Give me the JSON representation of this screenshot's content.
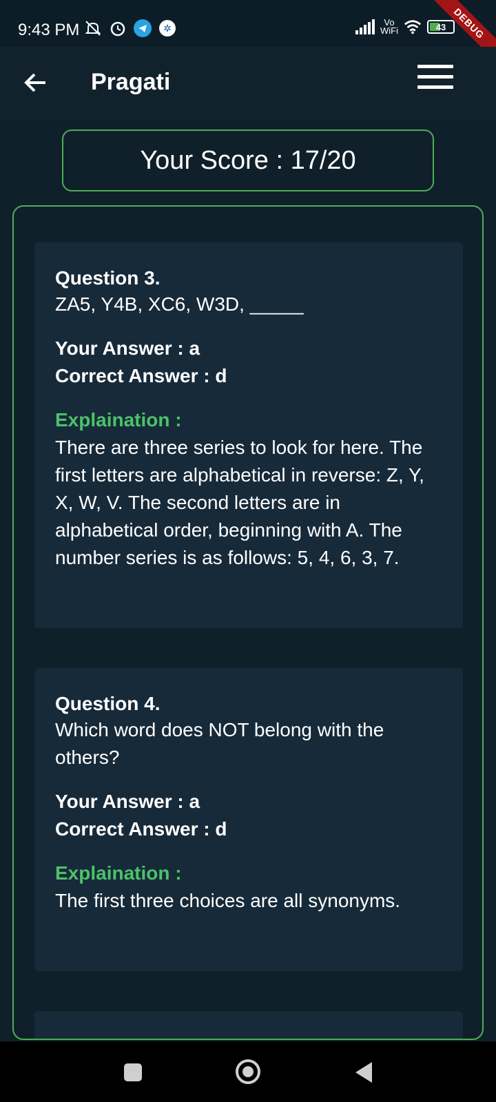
{
  "status_bar": {
    "time": "9:43 PM",
    "network_label": "Vo\nWiFi",
    "battery_level": "43",
    "debug_label": "DEBUG",
    "icons": [
      "mute-icon",
      "alarm-icon",
      "telegram-icon",
      "settings-badge-icon",
      "signal-icon",
      "wifi-icon",
      "battery-icon"
    ]
  },
  "app_bar": {
    "title": "Pragati",
    "icons": [
      "back-arrow-icon",
      "menu-icon"
    ]
  },
  "score": {
    "text": "Your Score : 17/20"
  },
  "questions": [
    {
      "title": "Question 3.",
      "text": "ZA5, Y4B, XC6, W3D, _____",
      "your_answer": "Your Answer : a",
      "correct_answer": "Correct Answer : d",
      "explanation_label": "Explaination :",
      "explanation": "There are three series to look for here. The first letters are alphabetical in reverse: Z, Y, X, W, V. The second letters are in alphabetical order, beginning with A. The number series is as follows: 5, 4, 6, 3, 7."
    },
    {
      "title": "Question 4.",
      "text": "Which word does NOT belong with the others?",
      "your_answer": "Your Answer : a",
      "correct_answer": "Correct Answer : d",
      "explanation_label": "Explaination :",
      "explanation": "The first three choices are all synonyms."
    }
  ],
  "colors": {
    "background": "#10202a",
    "card": "#172a39",
    "accent_green": "#4cae5a",
    "explanation_green": "#4cc16a"
  }
}
